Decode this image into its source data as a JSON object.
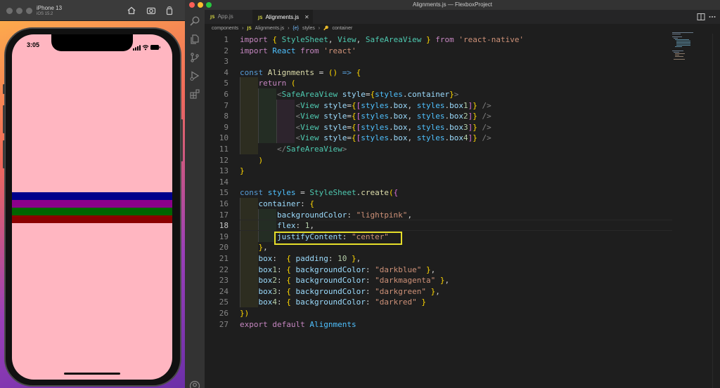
{
  "simulator": {
    "device_name": "iPhone 13",
    "ios_version": "iOS 15.2",
    "status_time": "3:05",
    "screen_bg": "#ffb6c1",
    "boxes": [
      {
        "name": "box1",
        "color": "#00008b"
      },
      {
        "name": "box2",
        "color": "#8b008b"
      },
      {
        "name": "box3",
        "color": "#006400"
      },
      {
        "name": "box4",
        "color": "#8b0000"
      }
    ]
  },
  "window": {
    "title": "Alignments.js — FlexboxProject"
  },
  "tabs": [
    {
      "badge": "JS",
      "label": "App.js",
      "active": false
    },
    {
      "badge": "JS",
      "label": "Alignments.js",
      "active": true
    }
  ],
  "tab_close": "✕",
  "breadcrumb": {
    "folder": "components",
    "sep1": "›",
    "file_badge": "JS",
    "file": "Alignments.js",
    "sep2": "›",
    "symbol_badge": "{e}",
    "symbol": "styles",
    "sep3": "›",
    "prop_badge": "🔑",
    "prop": "container"
  },
  "editor": {
    "current_line": 18,
    "highlighted_line": 19,
    "lines": [
      {
        "n": "1",
        "text": "import { StyleSheet, View, SafeAreaView } from 'react-native'"
      },
      {
        "n": "2",
        "text": "import React from 'react'"
      },
      {
        "n": "3",
        "text": ""
      },
      {
        "n": "4",
        "text": "const Alignments = () => {"
      },
      {
        "n": "5",
        "text": "    return ("
      },
      {
        "n": "6",
        "text": "        <SafeAreaView style={styles.container}>"
      },
      {
        "n": "7",
        "text": "            <View style={[styles.box, styles.box1]} />"
      },
      {
        "n": "8",
        "text": "            <View style={[styles.box, styles.box2]} />"
      },
      {
        "n": "9",
        "text": "            <View style={[styles.box, styles.box3]} />"
      },
      {
        "n": "10",
        "text": "            <View style={[styles.box, styles.box4]} />"
      },
      {
        "n": "11",
        "text": "        </SafeAreaView>"
      },
      {
        "n": "12",
        "text": "    )"
      },
      {
        "n": "13",
        "text": "}"
      },
      {
        "n": "14",
        "text": ""
      },
      {
        "n": "15",
        "text": "const styles = StyleSheet.create({"
      },
      {
        "n": "16",
        "text": "    container: {"
      },
      {
        "n": "17",
        "text": "        backgroundColor: \"lightpink\","
      },
      {
        "n": "18",
        "text": "        flex: 1,"
      },
      {
        "n": "19",
        "text": "        justifyContent: \"center\""
      },
      {
        "n": "20",
        "text": "    },"
      },
      {
        "n": "21",
        "text": "    box:  { padding: 10 },"
      },
      {
        "n": "22",
        "text": "    box1: { backgroundColor: \"darkblue\" },"
      },
      {
        "n": "23",
        "text": "    box2: { backgroundColor: \"darkmagenta\" },"
      },
      {
        "n": "24",
        "text": "    box3: { backgroundColor: \"darkgreen\" },"
      },
      {
        "n": "25",
        "text": "    box4: { backgroundColor: \"darkred\" }"
      },
      {
        "n": "26",
        "text": "})"
      },
      {
        "n": "27",
        "text": "export default Alignments"
      }
    ]
  },
  "colors": {
    "editor_bg": "#1e1e1e",
    "highlight_box": "#e6de2a",
    "activity_bar": "#333333"
  }
}
